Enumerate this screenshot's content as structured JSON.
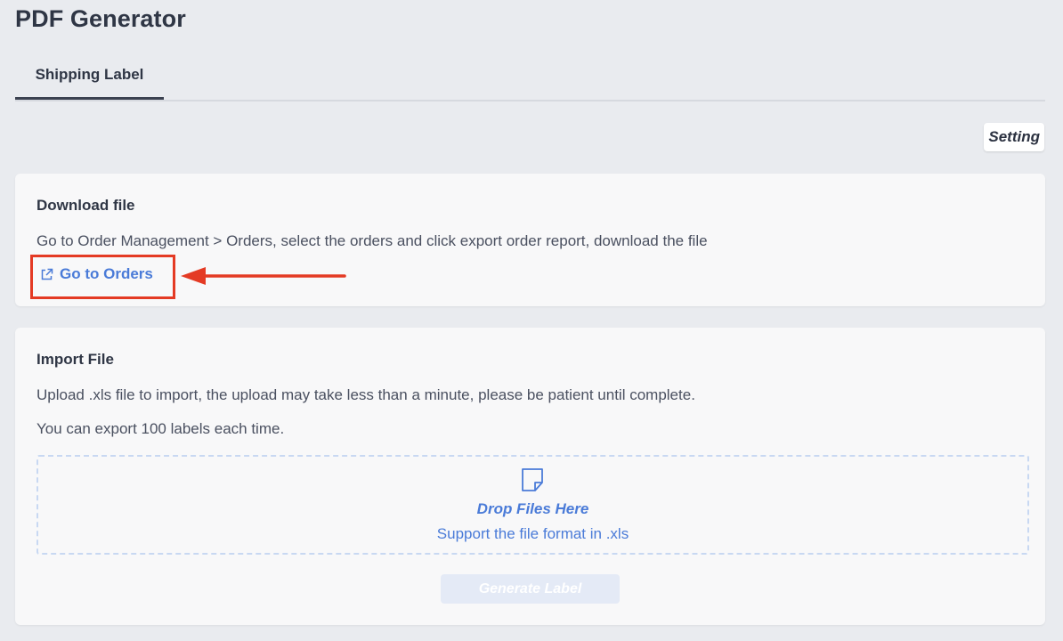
{
  "page": {
    "title": "PDF Generator"
  },
  "tabs": [
    {
      "label": "Shipping Label",
      "active": true
    }
  ],
  "toolbar": {
    "setting_label": "Setting"
  },
  "download_card": {
    "title": "Download file",
    "description": "Go to Order Management > Orders, select the orders and click export order report, download the file",
    "link_label": "Go to Orders",
    "link_icon": "external-link-icon"
  },
  "import_card": {
    "title": "Import File",
    "description": "Upload .xls file to import, the upload may take less than a minute, please be patient until complete.",
    "limit_text": "You can export 100 labels each time.",
    "dropzone": {
      "icon": "file-note-icon",
      "title": "Drop Files Here",
      "subtitle": "Support the file format in .xls"
    },
    "generate_label": "Generate Label",
    "generate_disabled": true
  },
  "colors": {
    "background": "#e9ebef",
    "card": "#f8f8f9",
    "accent": "#4a7bd8",
    "highlight": "#e43a24",
    "disabled_button": "#e4eaf6"
  }
}
